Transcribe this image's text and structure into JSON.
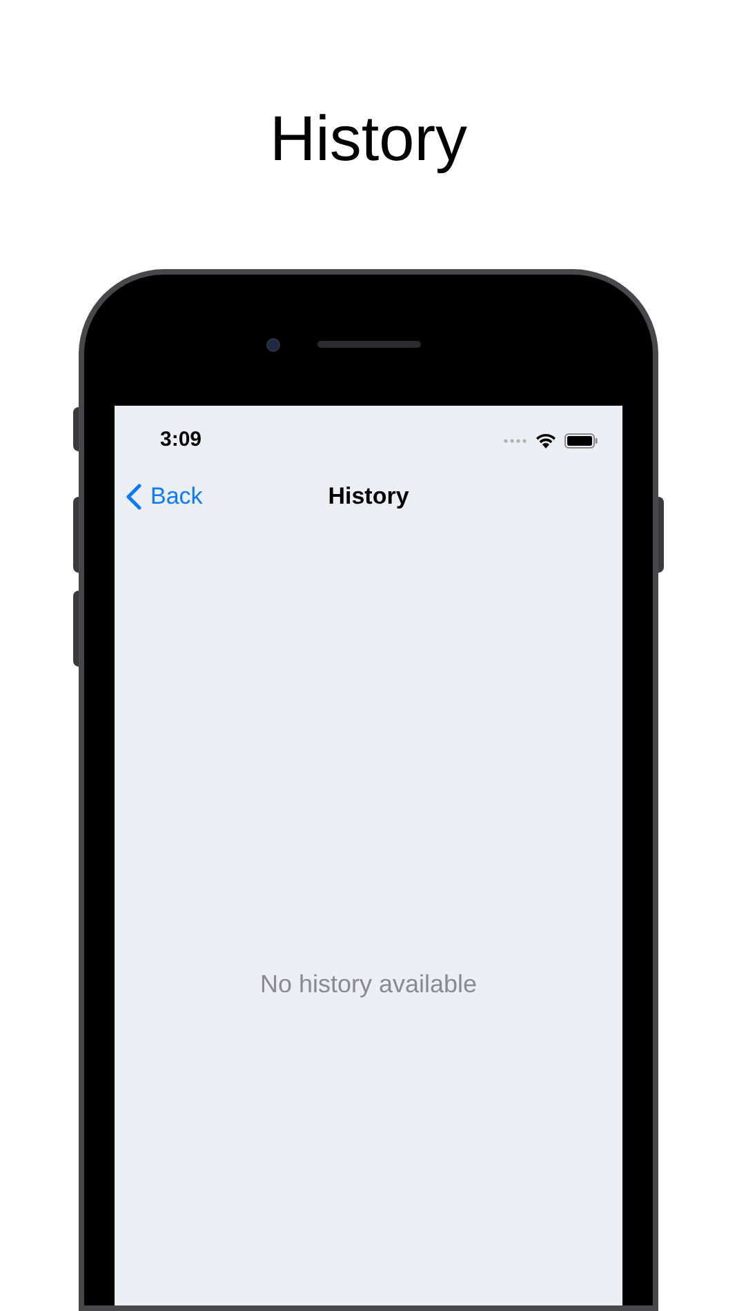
{
  "page_title": "History",
  "status_bar": {
    "time": "3:09"
  },
  "nav_bar": {
    "back_label": "Back",
    "title": "History"
  },
  "empty_state": "No history available"
}
